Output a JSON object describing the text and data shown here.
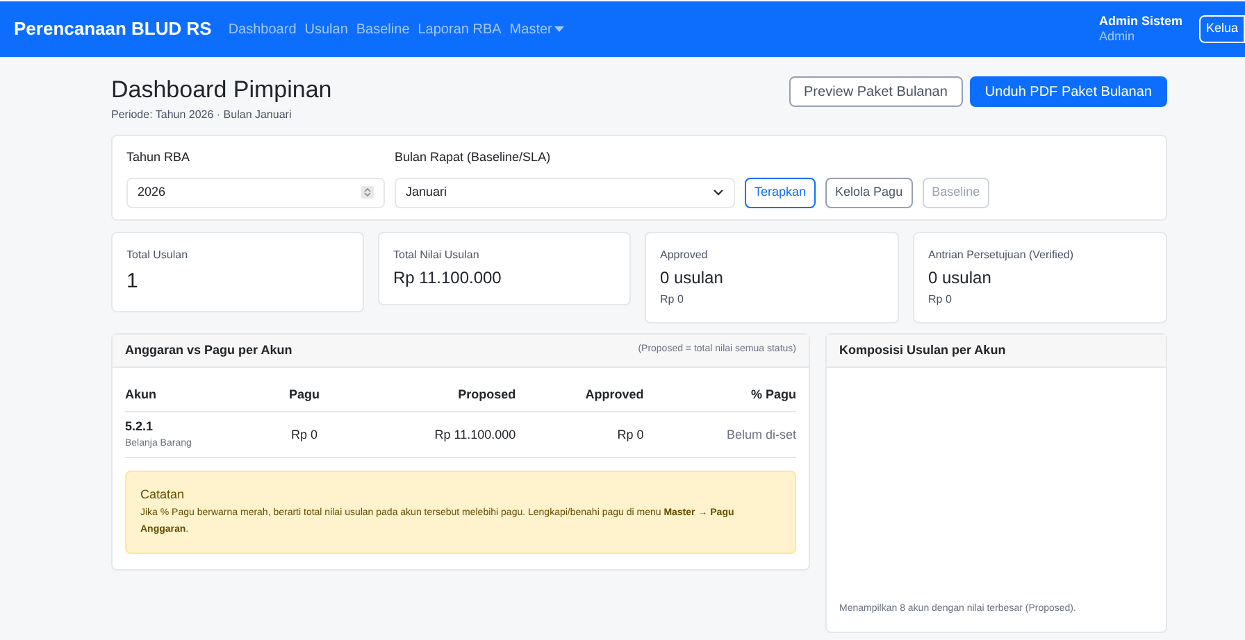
{
  "navbar": {
    "brand": "Perencanaan BLUD RS",
    "links": [
      {
        "label": "Dashboard",
        "dropdown": false
      },
      {
        "label": "Usulan",
        "dropdown": false
      },
      {
        "label": "Baseline",
        "dropdown": false
      },
      {
        "label": "Laporan RBA",
        "dropdown": false
      },
      {
        "label": "Master",
        "dropdown": true
      }
    ],
    "user_name": "Admin Sistem",
    "user_role": "Admin",
    "logout": "Kelua"
  },
  "header": {
    "title": "Dashboard Pimpinan",
    "subtitle": "Periode: Tahun 2026 · Bulan Januari",
    "buttons": [
      {
        "label": "Preview Paket Bulanan",
        "kind": "outline"
      },
      {
        "label": "Unduh PDF Paket Bulanan",
        "kind": "primary"
      }
    ]
  },
  "filters": {
    "year_label": "Tahun RBA",
    "year_value": "2026",
    "month_label": "Bulan Rapat (Baseline/SLA)",
    "month_value": "Januari",
    "buttons": [
      {
        "label": "Terapkan",
        "kind": "outline-primary"
      },
      {
        "label": "Kelola Pagu",
        "kind": "outline-secondary"
      },
      {
        "label": "Baseline",
        "kind": "outline-light"
      }
    ]
  },
  "stats": [
    {
      "label": "Total Usulan",
      "value": "1",
      "kind": "big"
    },
    {
      "label": "Total Nilai Usulan",
      "value": "Rp 11.100.000",
      "kind": "normal"
    },
    {
      "label": "Approved",
      "value": "0 usulan",
      "sub": "Rp 0",
      "kind": "normal"
    },
    {
      "label": "Antrian Persetujuan (Verified)",
      "value": "0 usulan",
      "sub": "Rp 0",
      "kind": "normal"
    }
  ],
  "budget_card": {
    "title": "Anggaran vs Pagu per Akun",
    "hint": "(Proposed = total nilai semua status)",
    "table": {
      "columns": [
        "Akun",
        "Pagu",
        "Proposed",
        "Approved",
        "% Pagu"
      ],
      "rows": [
        {
          "code": "5.2.1",
          "name": "Belanja Barang",
          "pagu": "Rp 0",
          "proposed": "Rp 11.100.000",
          "approved": "Rp 0",
          "percent": "Belum di-set"
        }
      ]
    },
    "note": {
      "title": "Catatan",
      "text": "Jika % Pagu berwarna merah, berarti total nilai usulan pada akun tersebut melebihi pagu. Lengkapi/benahi pagu di menu **Master → Pagu Anggaran**."
    }
  },
  "composition_card": {
    "title": "Komposisi Usulan per Akun",
    "footer": "Menampilkan 8 akun dengan nilai terbesar (Proposed)."
  }
}
